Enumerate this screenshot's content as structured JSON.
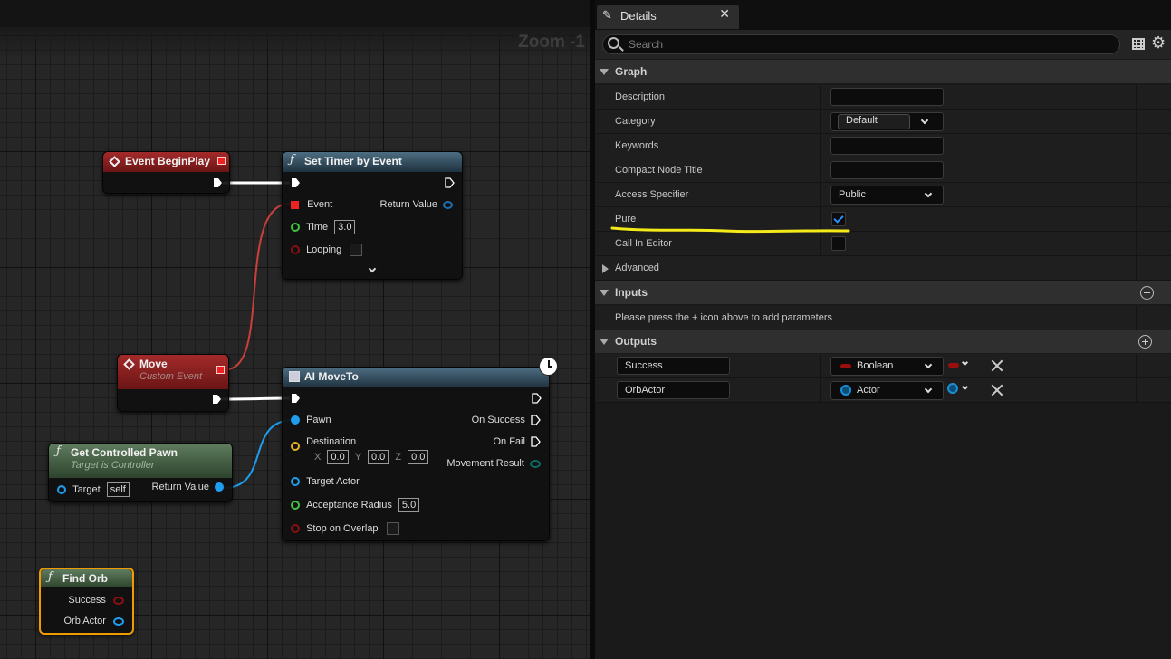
{
  "graph": {
    "zoom_label": "Zoom -1",
    "nodes": {
      "begin_play": {
        "title": "Event BeginPlay"
      },
      "set_timer": {
        "title": "Set Timer by Event",
        "pins": {
          "event": "Event",
          "time": "Time",
          "time_value": "3.0",
          "looping": "Looping",
          "return_value": "Return Value"
        }
      },
      "move": {
        "title": "Move",
        "subtitle": "Custom Event"
      },
      "ai_move_to": {
        "title": "AI MoveTo",
        "pins": {
          "pawn": "Pawn",
          "destination": "Destination",
          "x_label": "X",
          "x_value": "0.0",
          "y_label": "Y",
          "y_value": "0.0",
          "z_label": "Z",
          "z_value": "0.0",
          "target_actor": "Target Actor",
          "acceptance_radius": "Acceptance Radius",
          "acceptance_radius_value": "5.0",
          "stop_on_overlap": "Stop on Overlap",
          "on_success": "On Success",
          "on_fail": "On Fail",
          "movement_result": "Movement Result"
        }
      },
      "get_controlled_pawn": {
        "title": "Get Controlled Pawn",
        "subtitle": "Target is Controller",
        "pins": {
          "target": "Target",
          "target_value": "self",
          "return_value": "Return Value"
        }
      },
      "find_orb": {
        "title": "Find Orb",
        "pins": {
          "success": "Success",
          "orb_actor": "Orb Actor"
        }
      }
    }
  },
  "details": {
    "tab_label": "Details",
    "search_placeholder": "Search",
    "sections": {
      "graph": "Graph",
      "advanced": "Advanced",
      "inputs": "Inputs",
      "outputs": "Outputs"
    },
    "graph_props": {
      "description": "Description",
      "category": "Category",
      "category_value": "Default",
      "keywords": "Keywords",
      "compact_node_title": "Compact Node Title",
      "access_specifier": "Access Specifier",
      "access_specifier_value": "Public",
      "pure": "Pure",
      "pure_checked": true,
      "call_in_editor": "Call In Editor",
      "call_in_editor_checked": false
    },
    "inputs_hint": "Please press the + icon above to add parameters",
    "outputs": [
      {
        "name": "Success",
        "type": "Boolean",
        "type_color": "#9b0e0e"
      },
      {
        "name": "OrbActor",
        "type": "Actor",
        "type_color": "#1a8fd6"
      }
    ]
  },
  "colors": {
    "exec_wire": "#ffffff",
    "delegate_wire": "#c9403b",
    "object_wire": "#1f9ef0",
    "highlight": "#f4ea1a"
  }
}
